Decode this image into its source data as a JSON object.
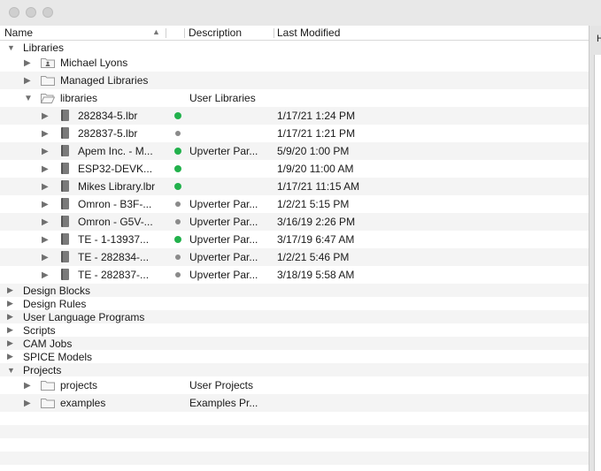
{
  "window": {
    "traffic_lights": [
      "close",
      "minimize",
      "zoom"
    ],
    "right_pane_label": "H"
  },
  "columns": {
    "name": "Name",
    "description": "Description",
    "last_modified": "Last Modified"
  },
  "tree": {
    "libraries": "Libraries",
    "michael_lyons": "Michael Lyons",
    "managed_libraries": "Managed Libraries",
    "libraries_folder": {
      "name": "libraries",
      "description": "User Libraries"
    },
    "lib_items": [
      {
        "name": "282834-5.lbr",
        "status": "green",
        "description": "",
        "modified": "1/17/21 1:24 PM"
      },
      {
        "name": "282837-5.lbr",
        "status": "gray",
        "description": "",
        "modified": "1/17/21 1:21 PM"
      },
      {
        "name": "Apem Inc. - M...",
        "status": "green",
        "description": "Upverter Par...",
        "modified": "5/9/20 1:00 PM"
      },
      {
        "name": "ESP32-DEVK...",
        "status": "green",
        "description": "",
        "modified": "1/9/20 11:00 AM"
      },
      {
        "name": "Mikes Library.lbr",
        "status": "green",
        "description": "",
        "modified": "1/17/21 11:15 AM"
      },
      {
        "name": "Omron - B3F-...",
        "status": "gray",
        "description": "Upverter Par...",
        "modified": "1/2/21 5:15 PM"
      },
      {
        "name": "Omron - G5V-...",
        "status": "gray",
        "description": "Upverter Par...",
        "modified": "3/16/19 2:26 PM"
      },
      {
        "name": "TE - 1-13937...",
        "status": "green",
        "description": "Upverter Par...",
        "modified": "3/17/19 6:47 AM"
      },
      {
        "name": "TE - 282834-...",
        "status": "gray",
        "description": "Upverter Par...",
        "modified": "1/2/21 5:46 PM"
      },
      {
        "name": "TE - 282837-...",
        "status": "gray",
        "description": "Upverter Par...",
        "modified": "3/18/19 5:58 AM"
      }
    ],
    "categories": [
      "Design Blocks",
      "Design Rules",
      "User Language Programs",
      "Scripts",
      "CAM Jobs",
      "SPICE Models"
    ],
    "projects": "Projects",
    "project_items": [
      {
        "name": "projects",
        "description": "User Projects"
      },
      {
        "name": "examples",
        "description": "Examples Pr..."
      }
    ]
  },
  "colors": {
    "status_green": "#22b14c",
    "status_gray": "#8a8a8a",
    "row_alt": "#f4f4f4"
  }
}
